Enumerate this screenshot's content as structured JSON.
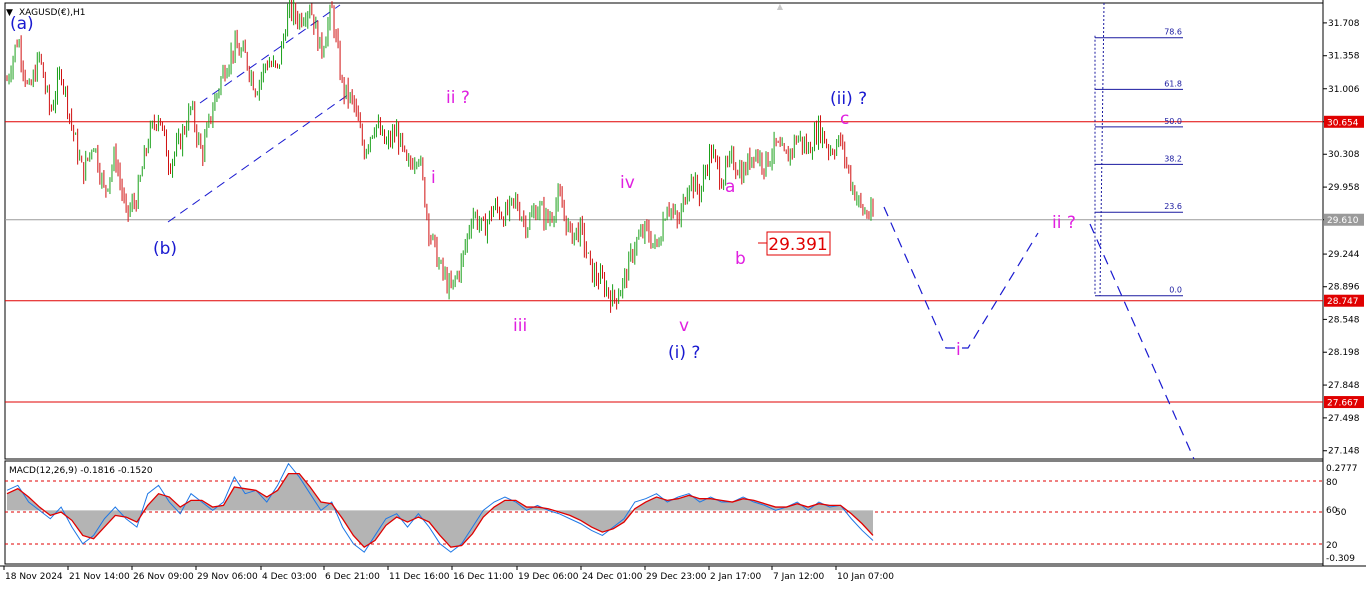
{
  "symbol": {
    "title": "XAGUSD(€),H1",
    "menu_icon": "triangle-down-icon"
  },
  "macd": {
    "title": "MACD(12,26,9) -0.1816 -0.1520",
    "axis_labels": [
      "0.2777",
      "80",
      "60",
      "50",
      "20",
      "-0.309"
    ]
  },
  "price_axis": {
    "ticks": [
      "31.708",
      "31.358",
      "31.006",
      "30.654",
      "30.308",
      "29.958",
      "29.610",
      "29.244",
      "28.896",
      "28.548",
      "28.198",
      "27.848",
      "27.498",
      "27.148"
    ],
    "marker_up_icon": "triangle-up-icon"
  },
  "horizontal_lines": [
    {
      "price": 30.654,
      "label": "30.654",
      "color": "#e00000"
    },
    {
      "price": 28.747,
      "label": "28.747",
      "color": "#e00000"
    },
    {
      "price": 27.667,
      "label": "27.667",
      "color": "#e00000"
    },
    {
      "price": 29.61,
      "label": "29.610",
      "color": "#9a9a9a"
    }
  ],
  "fibonacci": {
    "color": "#1a1aa0",
    "levels": [
      {
        "label": "78.6",
        "price": 31.55
      },
      {
        "label": "61.8",
        "price": 31.0
      },
      {
        "label": "50.0",
        "price": 30.6
      },
      {
        "label": "38.2",
        "price": 30.2
      },
      {
        "label": "23.6",
        "price": 29.69
      },
      {
        "label": "0.0",
        "price": 28.8
      }
    ]
  },
  "price_box": {
    "label": "29.391",
    "color": "#e00000"
  },
  "wave_labels": [
    {
      "id": "a-paren",
      "text": "(a)",
      "color": "#1a1ad0"
    },
    {
      "id": "b-paren",
      "text": "(b)",
      "color": "#1a1ad0"
    },
    {
      "id": "i-paren",
      "text": "(i) ?",
      "color": "#1a1ad0"
    },
    {
      "id": "ii-paren",
      "text": "(ii) ?",
      "color": "#1a1ad0"
    },
    {
      "id": "i-small",
      "text": "i",
      "color": "#e020e0"
    },
    {
      "id": "ii-small",
      "text": "ii ?",
      "color": "#e020e0"
    },
    {
      "id": "iii-small",
      "text": "iii",
      "color": "#e020e0"
    },
    {
      "id": "iv-small",
      "text": "iv",
      "color": "#e020e0"
    },
    {
      "id": "v-small",
      "text": "v",
      "color": "#e020e0"
    },
    {
      "id": "a-small",
      "text": "a",
      "color": "#e020e0"
    },
    {
      "id": "b-small",
      "text": "b",
      "color": "#e020e0"
    },
    {
      "id": "c-small",
      "text": "c",
      "color": "#e020e0"
    },
    {
      "id": "i-proj",
      "text": "i",
      "color": "#e020e0"
    },
    {
      "id": "ii-proj",
      "text": "ii ?",
      "color": "#e020e0"
    }
  ],
  "chart_data": {
    "type": "candlestick",
    "timeframe": "H1",
    "x_ticks": [
      "18 Nov 2024",
      "21 Nov 14:00",
      "26 Nov 09:00",
      "29 Nov 06:00",
      "4 Dec 03:00",
      "6 Dec 21:00",
      "11 Dec 16:00",
      "16 Dec 11:00",
      "19 Dec 06:00",
      "24 Dec 01:00",
      "29 Dec 23:00",
      "2 Jan 17:00",
      "7 Jan 12:00",
      "10 Jan 07:00"
    ],
    "ylim": [
      27.06,
      31.92
    ],
    "price_path": [
      31.1,
      31.55,
      30.95,
      31.35,
      30.75,
      31.2,
      30.6,
      30.1,
      30.45,
      29.9,
      30.3,
      29.65,
      29.85,
      30.45,
      30.75,
      30.2,
      30.45,
      30.8,
      30.3,
      30.8,
      31.2,
      31.45,
      31.35,
      31.0,
      31.3,
      31.2,
      31.85,
      31.75,
      31.9,
      31.4,
      31.85,
      31.0,
      30.85,
      30.35,
      30.65,
      30.4,
      30.55,
      30.15,
      30.35,
      29.5,
      29.1,
      28.85,
      29.15,
      29.7,
      29.5,
      29.75,
      29.65,
      29.8,
      29.55,
      29.75,
      29.6,
      29.85,
      29.45,
      29.5,
      29.05,
      28.95,
      28.75,
      28.95,
      29.35,
      29.5,
      29.3,
      29.8,
      29.55,
      30.05,
      29.9,
      30.35,
      30.05,
      30.25,
      30.1,
      30.35,
      30.2,
      30.4,
      30.25,
      30.5,
      30.35,
      30.6,
      30.35,
      30.45,
      30.0,
      29.7,
      29.65
    ],
    "macd_ylim": [
      -0.309,
      0.2777
    ],
    "macd_main": [
      0.12,
      0.15,
      0.05,
      0.0,
      -0.05,
      0.02,
      -0.1,
      -0.2,
      -0.15,
      -0.05,
      0.02,
      -0.05,
      -0.1,
      0.1,
      0.15,
      0.05,
      -0.02,
      0.1,
      0.05,
      0.0,
      0.05,
      0.2,
      0.1,
      0.12,
      0.05,
      0.15,
      0.28,
      0.2,
      0.1,
      0.0,
      0.05,
      -0.1,
      -0.2,
      -0.25,
      -0.15,
      -0.05,
      -0.02,
      -0.1,
      -0.02,
      -0.1,
      -0.2,
      -0.25,
      -0.2,
      -0.1,
      0.0,
      0.05,
      0.08,
      0.05,
      0.0,
      0.03,
      0.0,
      -0.02,
      -0.05,
      -0.08,
      -0.12,
      -0.15,
      -0.1,
      -0.05,
      0.05,
      0.07,
      0.1,
      0.05,
      0.08,
      0.1,
      0.05,
      0.08,
      0.05,
      0.05,
      0.08,
      0.05,
      0.03,
      0.0,
      0.02,
      0.05,
      0.0,
      0.05,
      0.02,
      0.03,
      -0.05,
      -0.12,
      -0.18
    ],
    "macd_signal": [
      0.1,
      0.13,
      0.08,
      0.02,
      -0.03,
      -0.01,
      -0.06,
      -0.15,
      -0.17,
      -0.1,
      -0.03,
      -0.04,
      -0.07,
      0.03,
      0.1,
      0.08,
      0.02,
      0.06,
      0.06,
      0.02,
      0.03,
      0.14,
      0.13,
      0.12,
      0.08,
      0.12,
      0.22,
      0.22,
      0.14,
      0.05,
      0.04,
      -0.05,
      -0.15,
      -0.22,
      -0.18,
      -0.09,
      -0.04,
      -0.07,
      -0.04,
      -0.07,
      -0.15,
      -0.22,
      -0.21,
      -0.14,
      -0.04,
      0.02,
      0.06,
      0.06,
      0.02,
      0.02,
      0.01,
      -0.01,
      -0.03,
      -0.06,
      -0.1,
      -0.13,
      -0.11,
      -0.07,
      0.01,
      0.05,
      0.08,
      0.06,
      0.07,
      0.09,
      0.07,
      0.07,
      0.06,
      0.05,
      0.07,
      0.06,
      0.04,
      0.02,
      0.02,
      0.04,
      0.02,
      0.04,
      0.03,
      0.03,
      -0.02,
      -0.08,
      -0.15
    ]
  }
}
